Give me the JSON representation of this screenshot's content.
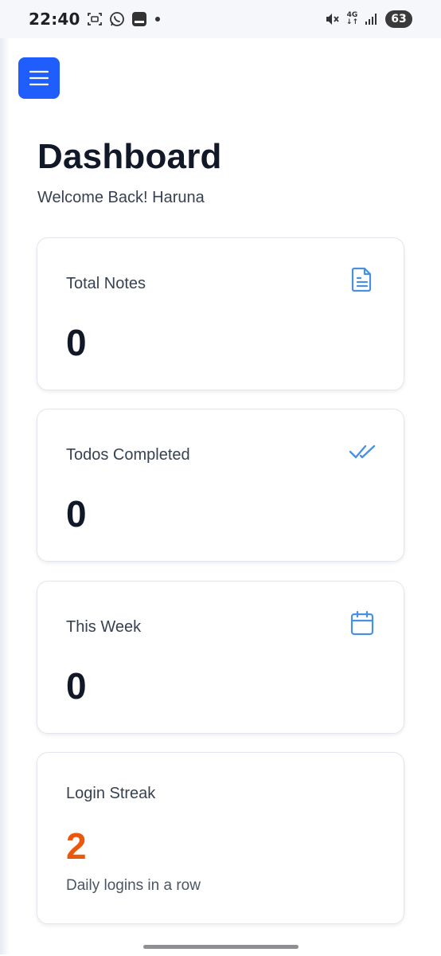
{
  "status_bar": {
    "time": "22:40",
    "network": {
      "line1": "4G",
      "line2": "↓↑"
    },
    "battery": "63"
  },
  "header": {
    "title": "Dashboard",
    "welcome": "Welcome Back! Haruna"
  },
  "cards": [
    {
      "label": "Total Notes",
      "value": "0",
      "icon": "document-icon"
    },
    {
      "label": "Todos Completed",
      "value": "0",
      "icon": "double-check-icon"
    },
    {
      "label": "This Week",
      "value": "0",
      "icon": "calendar-icon"
    },
    {
      "label": "Login Streak",
      "value": "2",
      "subtitle": "Daily logins in a row"
    }
  ],
  "colors": {
    "accent": "#1f5efc",
    "icon_blue": "#4a90e2",
    "streak_orange": "#ea580c",
    "text_dark": "#111827"
  }
}
